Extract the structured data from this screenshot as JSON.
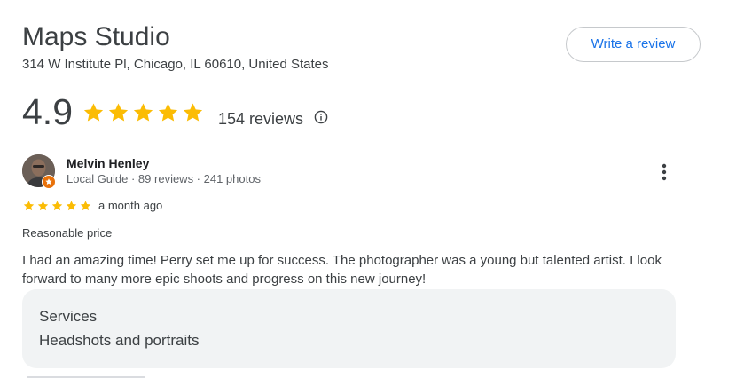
{
  "business": {
    "name": "Maps Studio",
    "address": "314 W Institute Pl, Chicago, IL 60610, United States",
    "write_review_label": "Write a review"
  },
  "rating": {
    "average": "4.9",
    "stars_filled": 5,
    "stars_total": 5,
    "review_count_text": "154 reviews"
  },
  "review": {
    "reviewer_name": "Melvin Henley",
    "reviewer_meta": "Local Guide · 89 reviews · 241 photos",
    "stars_filled": 5,
    "stars_total": 5,
    "time": "a month ago",
    "tag": "Reasonable price",
    "text": "I had an amazing time! Perry set me up for success. The photographer was a young but talented artist. I look forward to many more epic shoots and progress on this new journey!",
    "services_title": "Services",
    "services_value": "Headshots and portraits"
  },
  "colors": {
    "star": "#fbbc04",
    "accent_blue": "#1a73e8",
    "local_guide_badge": "#e8710a"
  },
  "icons": {
    "info": "info-icon",
    "more": "more-vertical-icon",
    "star": "star-icon"
  }
}
